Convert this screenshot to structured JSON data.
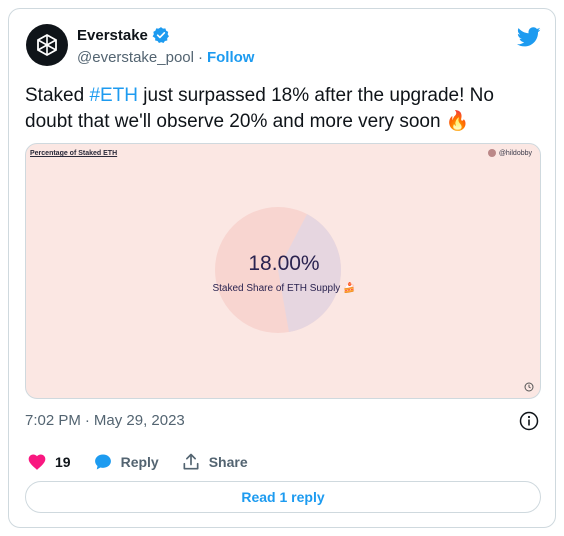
{
  "author": {
    "display_name": "Everstake",
    "handle": "@everstake_pool",
    "separator": "·",
    "follow_label": "Follow"
  },
  "tweet": {
    "text_before": "Staked ",
    "hashtag": "#ETH",
    "text_after": " just surpassed 18% after the upgrade! No doubt that we'll observe 20% and more very soon ",
    "emoji": "🔥"
  },
  "media": {
    "title": "Percentage of Staked ETH",
    "credit": "@hildobby",
    "value_text": "18.00%",
    "label": "Staked Share of ETH Supply",
    "label_emoji": "🍰",
    "staked_fraction": 0.18,
    "colors": {
      "background": "#fbe7e3",
      "pie_main": "#f8d5d0",
      "pie_slice": "#e6d6e0",
      "text": "#2a2350"
    }
  },
  "meta": {
    "time": "7:02 PM",
    "separator": "·",
    "date": "May 29, 2023"
  },
  "actions": {
    "likes_count": "19",
    "reply_label": "Reply",
    "share_label": "Share"
  },
  "read_reply_label": "Read 1 reply",
  "colors": {
    "accent": "#1d9bf0",
    "like": "#f91880",
    "muted": "#536471",
    "border": "#cfd9de"
  }
}
